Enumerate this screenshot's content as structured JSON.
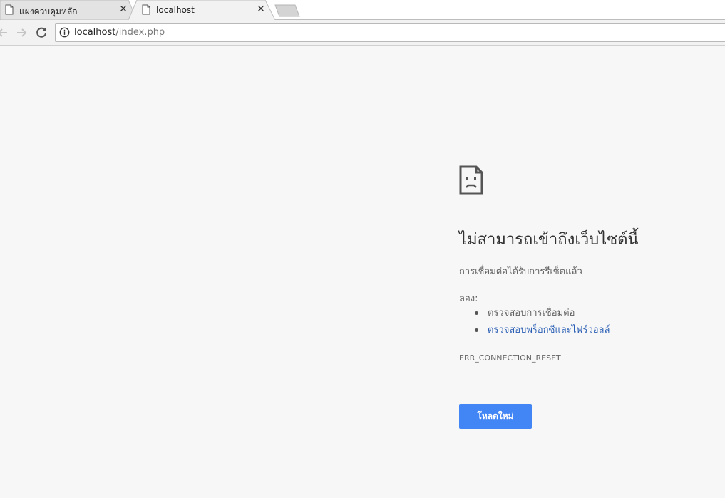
{
  "tabs": [
    {
      "title": "แผงควบคุมหลัก",
      "active": false
    },
    {
      "title": "localhost",
      "active": true
    }
  ],
  "toolbar": {
    "back_icon": "back-arrow-icon",
    "forward_icon": "forward-arrow-icon",
    "reload_icon": "reload-icon"
  },
  "omnibox": {
    "host": "localhost",
    "path": "/index.php",
    "security_icon": "info-icon"
  },
  "error_page": {
    "icon": "sad-page-icon",
    "heading": "ไม่สามารถเข้าถึงเว็บไซต์นี้",
    "description": "การเชื่อมต่อได้รับการรีเซ็ตแล้ว",
    "try_label": "ลอง:",
    "suggestions": [
      {
        "text": "ตรวจสอบการเชื่อมต่อ",
        "is_link": false
      },
      {
        "text": "ตรวจสอบพร็อกซีและไฟร์วอลล์",
        "is_link": true
      }
    ],
    "error_code": "ERR_CONNECTION_RESET",
    "reload_button": "โหลดใหม่"
  },
  "colors": {
    "accent": "#4285f4",
    "link": "#2b5fb5",
    "background": "#f7f7f7"
  }
}
